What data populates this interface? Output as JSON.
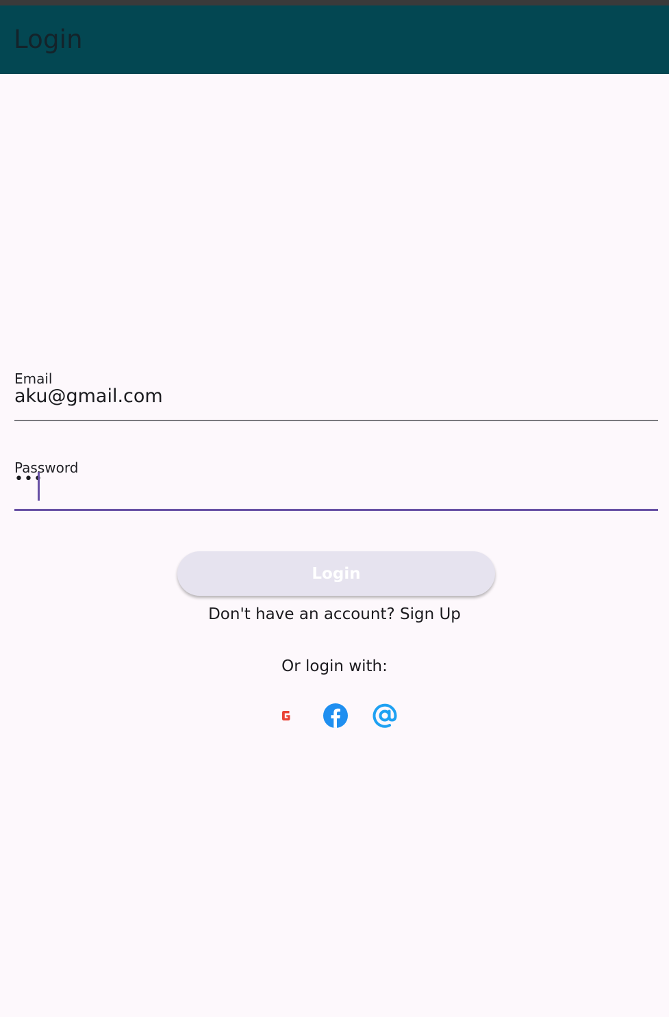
{
  "app_bar": {
    "title": "Login",
    "background_color": "#034752"
  },
  "form": {
    "email": {
      "label": "Email",
      "value": "aku@gmail.com"
    },
    "password": {
      "label": "Password",
      "value": "•••"
    },
    "login_button_label": "Login",
    "accent_color": "#6750a4"
  },
  "signup": {
    "text": "Don't have an account? Sign Up"
  },
  "social": {
    "heading": "Or login with:",
    "icons": [
      {
        "name": "google-icon",
        "color": "#ea4335"
      },
      {
        "name": "facebook-icon",
        "color": "#1f8ff0"
      },
      {
        "name": "at-icon",
        "color": "#1ea1f2"
      }
    ]
  }
}
